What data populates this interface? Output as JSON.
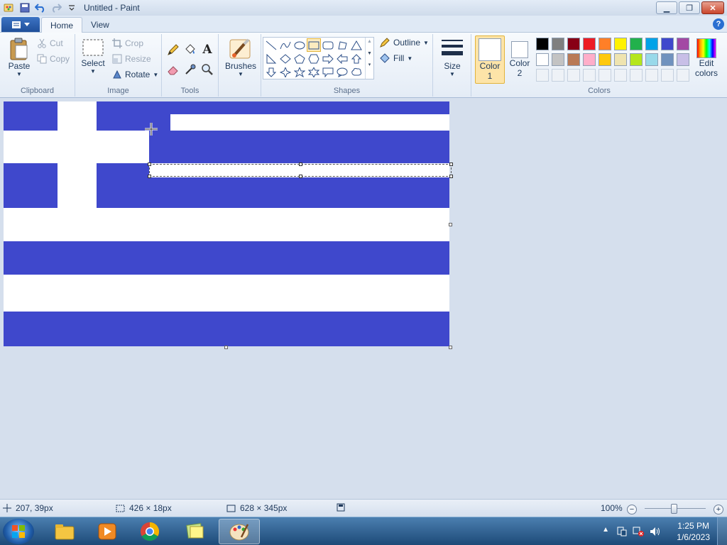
{
  "window": {
    "title": "Untitled - Paint"
  },
  "tabs": [
    {
      "label": "Home"
    },
    {
      "label": "View"
    }
  ],
  "ribbon": {
    "clipboard": {
      "label": "Clipboard",
      "paste": "Paste",
      "cut": "Cut",
      "copy": "Copy"
    },
    "image": {
      "label": "Image",
      "select": "Select",
      "crop": "Crop",
      "resize": "Resize",
      "rotate": "Rotate"
    },
    "tools": {
      "label": "Tools"
    },
    "brushes": {
      "label": "Brushes"
    },
    "shapes": {
      "label": "Shapes",
      "outline": "Outline",
      "fill": "Fill"
    },
    "size": {
      "label": "Size"
    },
    "colors": {
      "label": "Colors",
      "color1_label": "Color",
      "color1_num": "1",
      "color2_label": "Color",
      "color2_num": "2",
      "edit_label": "Edit",
      "edit_label2": "colors",
      "color1": "#ffffff",
      "color2": "#ffffff",
      "palette_row1": [
        "#000000",
        "#7f7f7f",
        "#880015",
        "#ed1c24",
        "#ff7f27",
        "#fff200",
        "#22b14c",
        "#00a2e8",
        "#3f48cc",
        "#a349a4"
      ],
      "palette_row2": [
        "#ffffff",
        "#c3c3c3",
        "#b97a57",
        "#ffaec9",
        "#ffc90e",
        "#efe4b0",
        "#b5e61d",
        "#99d9ea",
        "#7092be",
        "#c8bfe7"
      ]
    }
  },
  "canvas": {
    "flag_blue": "#3f48cc",
    "flag_white": "#ffffff"
  },
  "status": {
    "cursor_pos": "207, 39px",
    "selection_size": "426 × 18px",
    "canvas_size": "628 × 345px",
    "zoom": "100%"
  },
  "taskbar": {
    "time": "1:25 PM",
    "date": "1/6/2023"
  }
}
